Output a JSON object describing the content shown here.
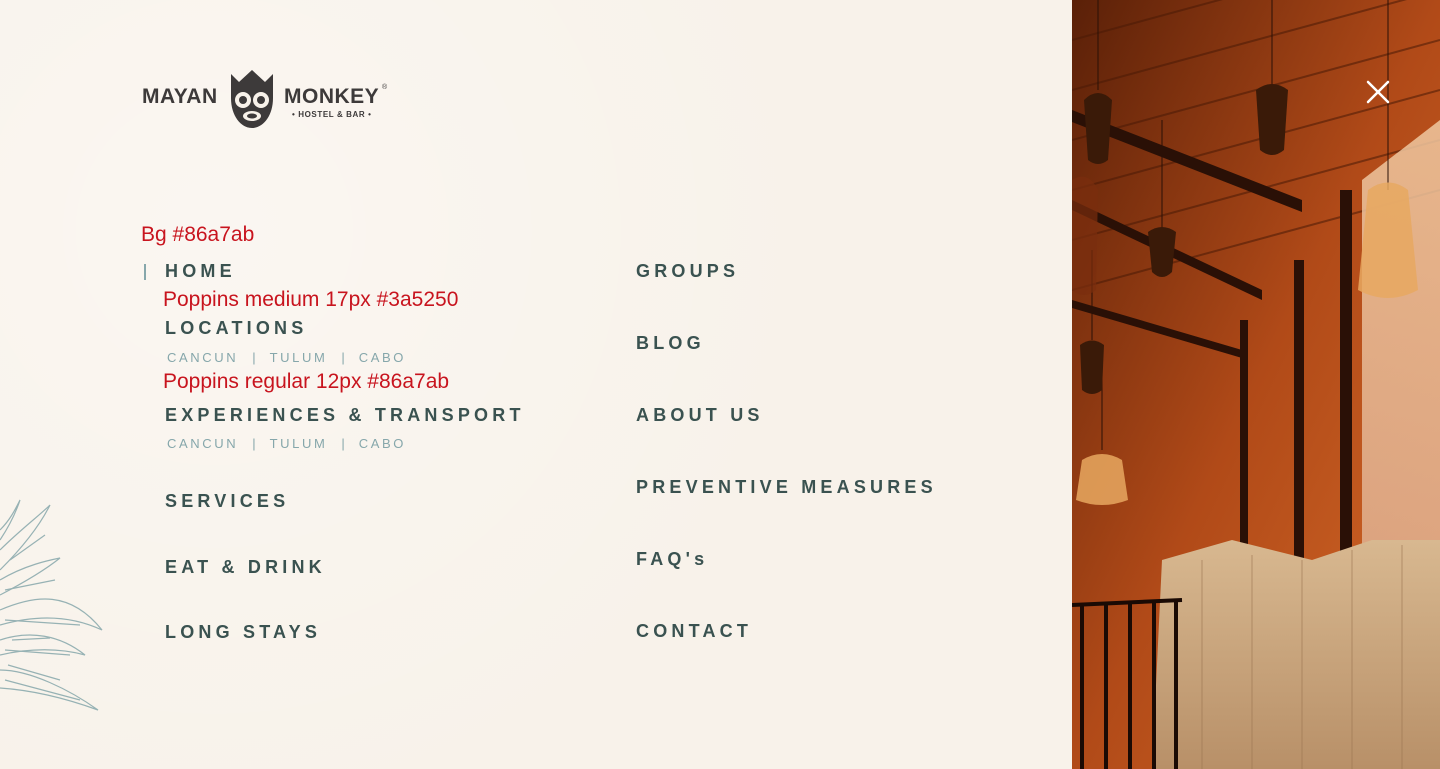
{
  "logo": {
    "word_left": "MAYAN",
    "word_right": "MONKEY",
    "subtitle": "• HOSTEL & BAR •",
    "registered": "®"
  },
  "annotations": {
    "bg_note": "Bg #86a7ab",
    "main_font_note": "Poppins medium 17px #3a5250",
    "sub_font_note": "Poppins regular 12px #86a7ab"
  },
  "nav": {
    "home": "HOME",
    "locations": "LOCATIONS",
    "locations_sub": [
      "CANCUN",
      "TULUM",
      "CABO"
    ],
    "experiences": "EXPERIENCES & TRANSPORT",
    "experiences_sub": [
      "CANCUN",
      "TULUM",
      "CABO"
    ],
    "services": "SERVICES",
    "eat_drink": "EAT & DRINK",
    "long_stays": "LONG STAYS",
    "groups": "GROUPS",
    "blog": "BLOG",
    "about_us": "ABOUT US",
    "preventive_measures": "PREVENTIVE MEASURES",
    "faqs": "FAQ's",
    "contact": "CONTACT",
    "separator": "|"
  },
  "colors": {
    "main_text": "#3a5250",
    "sub_text": "#86a7ab",
    "annotation": "#c8141e",
    "background": "#f8f2ea"
  },
  "icons": {
    "close": "close-icon",
    "logo_mark": "monkey-logo-icon",
    "leaf": "agave-leaf-decoration"
  }
}
